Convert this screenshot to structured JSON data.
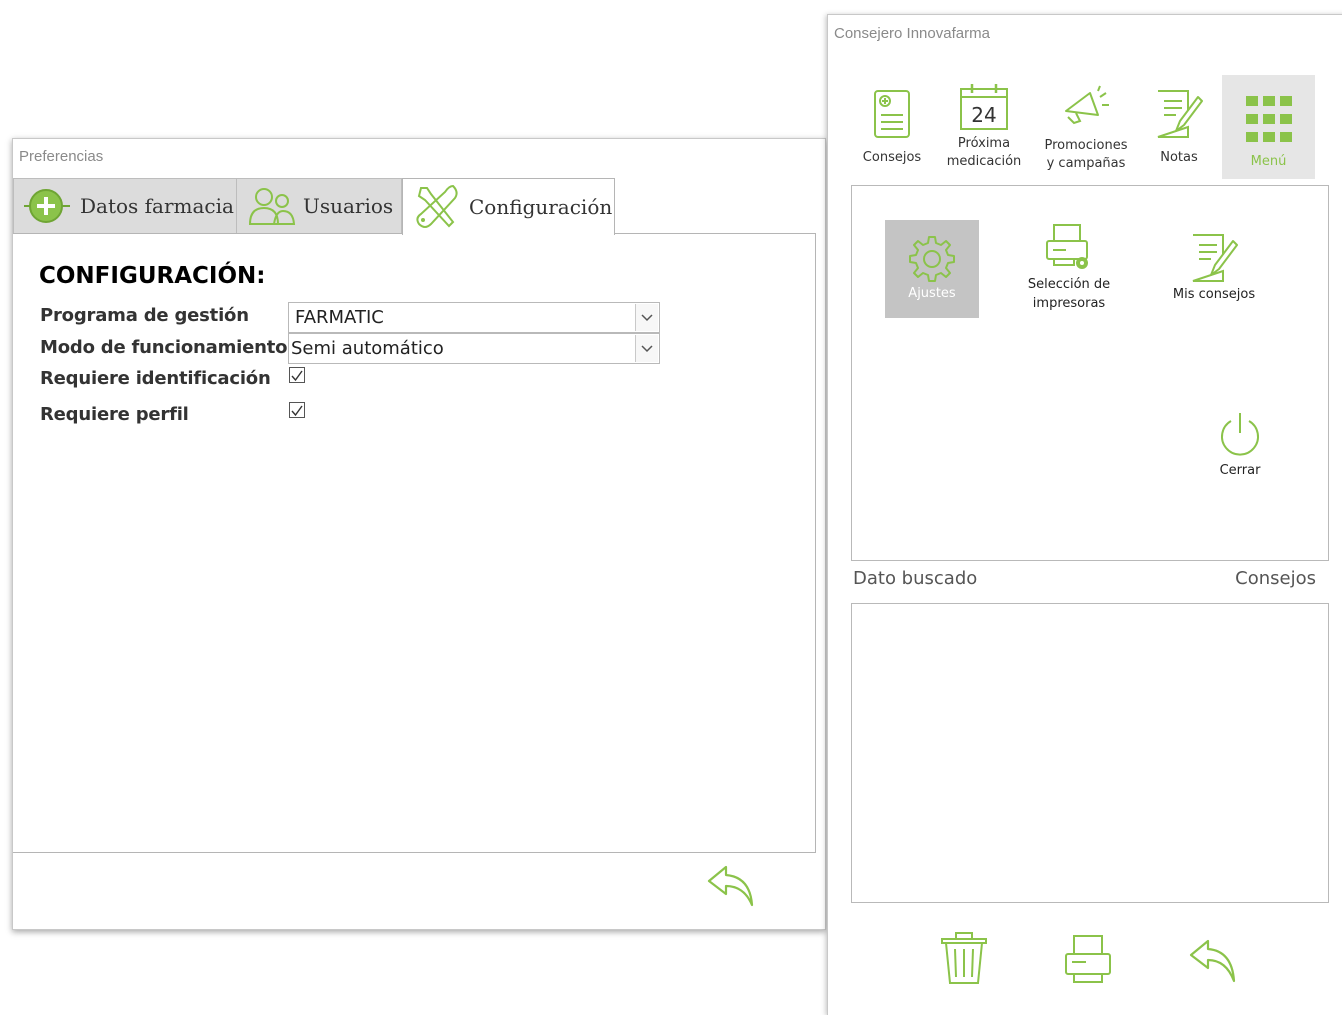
{
  "preferences": {
    "title": "Preferencias",
    "tabs": [
      {
        "label": "Datos farmacia",
        "icon": "plus-circle-icon"
      },
      {
        "label": "Usuarios",
        "icon": "users-icon"
      },
      {
        "label": "Configuración",
        "icon": "tools-icon"
      }
    ],
    "active_tab": "Configuración",
    "heading": "CONFIGURACIÓN:",
    "fields": {
      "programa_label": "Programa de gestión",
      "programa_value": "FARMATIC",
      "modo_label": "Modo de funcionamiento",
      "modo_value": "Semi automático",
      "identificacion_label": "Requiere identificación",
      "identificacion_checked": true,
      "perfil_label": "Requiere perfil",
      "perfil_checked": true
    },
    "back_icon": "reply-arrow-icon"
  },
  "consejero": {
    "title": "Consejero Innovafarma",
    "toolbar": [
      {
        "label": "Consejos",
        "icon": "clipboard-plus-icon"
      },
      {
        "label_line1": "Próxima",
        "label_line2": "medicación",
        "icon": "calendar-24-icon",
        "calendar_day": "24"
      },
      {
        "label_line1": "Promociones",
        "label_line2": "y campañas",
        "icon": "megaphone-icon"
      },
      {
        "label": "Notas",
        "icon": "note-pencil-icon"
      },
      {
        "label": "Menú",
        "icon": "grid-icon",
        "selected": true
      }
    ],
    "menu_items": [
      {
        "label": "Ajustes",
        "icon": "gear-icon",
        "selected": true
      },
      {
        "label_line1": "Selección de",
        "label_line2": "impresoras",
        "icon": "printer-gear-icon"
      },
      {
        "label": "Mis consejos",
        "icon": "note-pencil-icon"
      },
      {
        "label": "Cerrar",
        "icon": "power-icon"
      }
    ],
    "dato_buscado_label": "Dato buscado",
    "consejos_label": "Consejos",
    "bottom_buttons": [
      {
        "icon": "trash-icon"
      },
      {
        "icon": "printer-icon"
      },
      {
        "icon": "reply-arrow-icon"
      }
    ],
    "accent_color": "#8bc34a"
  }
}
